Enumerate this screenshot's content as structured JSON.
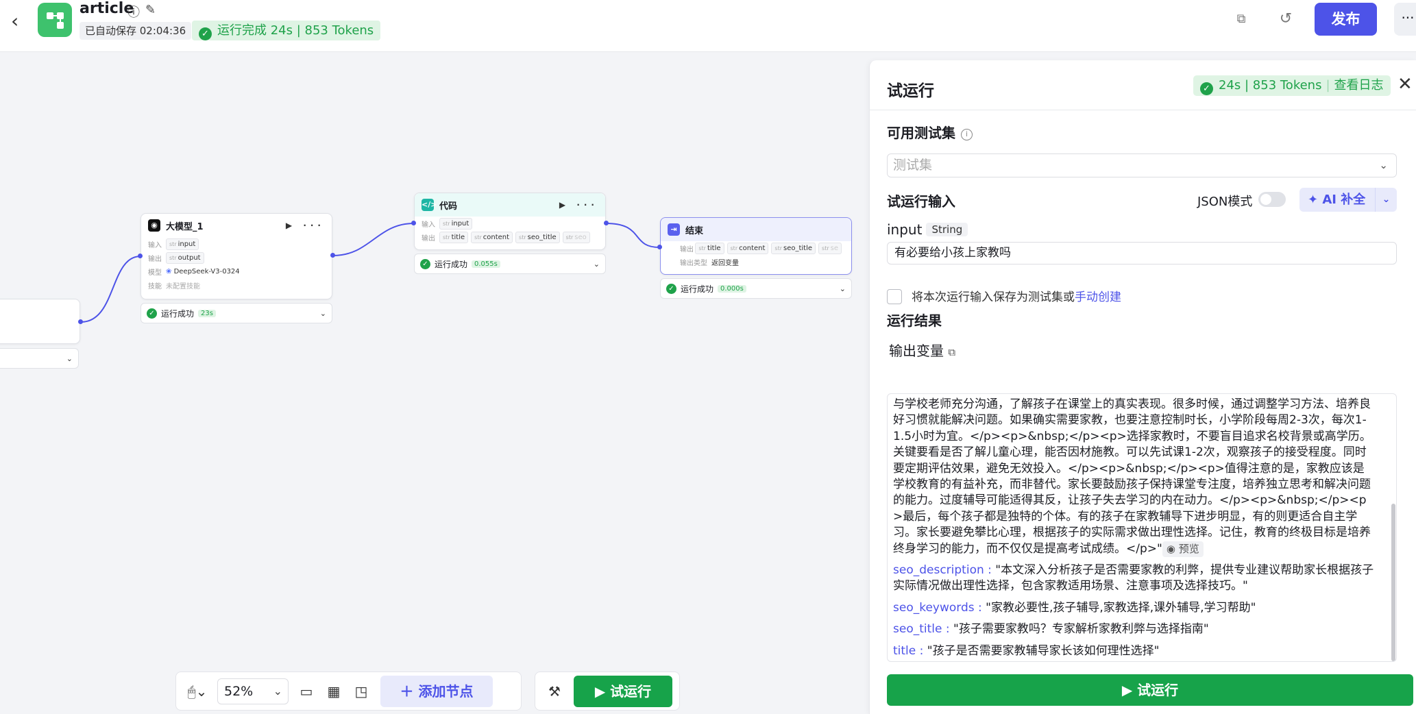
{
  "header": {
    "app_name": "article",
    "autosave": "已自动保存 02:04:36",
    "run_status": "运行完成 24s | 853 Tokens",
    "publish_label": "发布",
    "more_label": "···"
  },
  "canvas": {
    "nodes": {
      "llm": {
        "title": "大模型_1",
        "input_label": "输入",
        "input_var": "input",
        "output_label": "输出",
        "output_var": "output",
        "model_label": "模型",
        "model_value": "DeepSeek-V3-0324",
        "skill_label": "技能",
        "skill_value": "未配置技能",
        "status": "运行成功",
        "time": "23s"
      },
      "code": {
        "title": "代码",
        "input_label": "输入",
        "input_var": "input",
        "output_label": "输出",
        "out1": "title",
        "out2": "content",
        "out3": "seo_title",
        "out4": "seo",
        "status": "运行成功",
        "time": "0.055s"
      },
      "end": {
        "title": "结束",
        "output_label": "输出",
        "out1": "title",
        "out2": "content",
        "out3": "seo_title",
        "out4": "se",
        "type_label": "输出类型",
        "type_value": "返回变量",
        "status": "运行成功",
        "time": "0.000s"
      }
    },
    "type_prefix": "str",
    "chevron": "⌄"
  },
  "toolbar": {
    "zoom": "52%",
    "add_node": "添加节点",
    "test_run": "试运行"
  },
  "panel": {
    "title": "试运行",
    "run_info": "24s | 853 Tokens",
    "view_log": "查看日志",
    "testset_label": "可用测试集",
    "testset_placeholder": "测试集",
    "run_input_label": "试运行输入",
    "json_mode": "JSON模式",
    "ai_fill": "AI 补全",
    "input_name": "input",
    "input_type": "String",
    "input_value": "有必要给小孩上家教吗",
    "save_text": "将本次运行输入保存为测试集或",
    "manual_create": "手动创建",
    "result_label": "运行结果",
    "output_vars_label": "输出变量",
    "content_tail": "与学校老师充分沟通，了解孩子在课堂上的真实表现。很多时候，通过调整学习方法、培养良好习惯就能解决问题。如果确实需要家教，也要注意控制时长，小学阶段每周2-3次，每次1-1.5小时为宜。</p><p>&nbsp;</p><p>选择家教时，不要盲目追求名校背景或高学历。关键要看是否了解儿童心理，能否因材施教。可以先试课1-2次，观察孩子的接受程度。同时要定期评估效果，避免无效投入。</p><p>&nbsp;</p><p>值得注意的是，家教应该是学校教育的有益补充，而非替代。家长要鼓励孩子保持课堂专注度，培养独立思考和解决问题的能力。过度辅导可能适得其反，让孩子失去学习的内在动力。</p><p>&nbsp;</p><p>最后，每个孩子都是独特的个体。有的孩子在家教辅导下进步明显，有的则更适合自主学习。家长要避免攀比心理，根据孩子的实际需求做出理性选择。记住，教育的终极目标是培养终身学习的能力，而不仅仅是提高考试成绩。</p>\"",
    "preview_label": "预览",
    "outputs": [
      {
        "key": "seo_description :",
        "value": "\"本文深入分析孩子是否需要家教的利弊，提供专业建议帮助家长根据孩子实际情况做出理性选择，包含家教适用场景、注意事项及选择技巧。\""
      },
      {
        "key": "seo_keywords :",
        "value": "\"家教必要性,孩子辅导,家教选择,课外辅导,学习帮助\""
      },
      {
        "key": "seo_title :",
        "value": "\"孩子需要家教吗？专家解析家教利弊与选择指南\""
      },
      {
        "key": "title :",
        "value": "\"孩子是否需要家教辅导家长该如何理性选择\""
      }
    ],
    "run_button": "试运行"
  },
  "colors": {
    "accent": "#4d53e8",
    "success": "#17a34a",
    "brand": "#3ec26d"
  }
}
